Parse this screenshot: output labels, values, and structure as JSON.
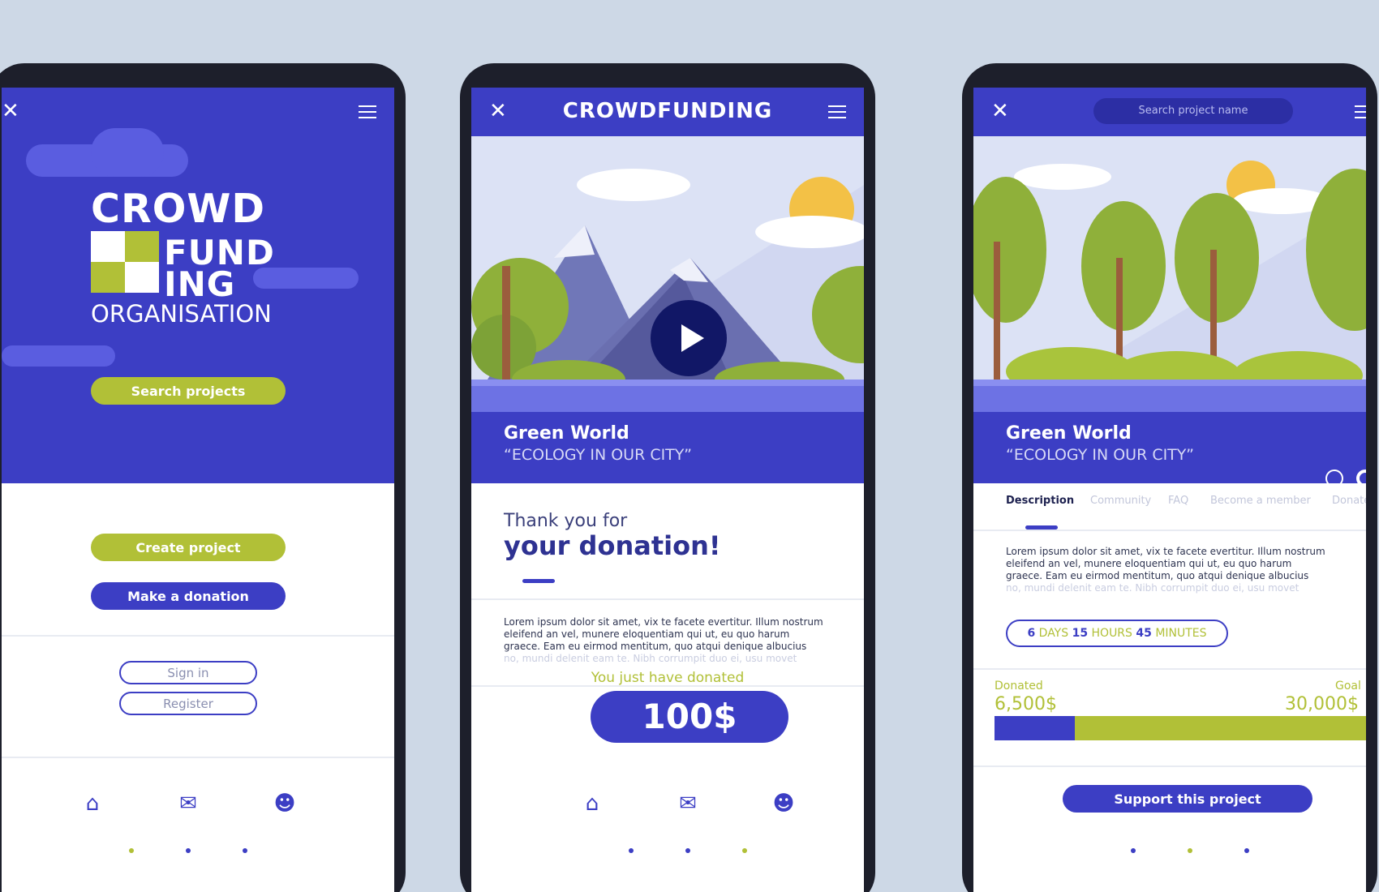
{
  "colors": {
    "background": "#cdd8e6",
    "primary": "#3c3ec4",
    "accent": "#b1c037",
    "device": "#1d1f2b"
  },
  "screen1": {
    "logo_line1": "CROWD",
    "logo_line2": "FUND",
    "logo_line3": "ING",
    "subtitle": "ORGANISATION",
    "search_button": "Search projects",
    "create_button": "Create project",
    "donate_button": "Make a donation",
    "signin_button": "Sign in",
    "register_button": "Register",
    "icons": [
      "close-icon",
      "menu-icon",
      "home-icon",
      "chat-icon",
      "users-icon"
    ]
  },
  "screen2": {
    "header_title": "CROWDFUNDING",
    "project_name": "Green World",
    "project_subtitle": "“ECOLOGY IN OUR CITY”",
    "thanks_line1": "Thank you for",
    "thanks_line2": "your donation!",
    "lorem": [
      "Lorem ipsum dolor sit amet, vix te facete evertitur. Illum nostrum",
      "eleifend an vel, munere eloquentiam qui ut, eu quo harum",
      "graece. Eam eu eirmod mentitum, quo atqui denique albucius",
      "no, mundi delenit eam te. Nibh corrumpit duo ei, usu movet"
    ],
    "donated_label": "You just have donated",
    "donated_amount": "100$"
  },
  "screen3": {
    "search_placeholder": "Search project name",
    "project_name": "Green World",
    "project_subtitle": "“ECOLOGY IN OUR CITY”",
    "tabs": [
      "Description",
      "Community",
      "FAQ",
      "Become a member",
      "Donate"
    ],
    "lorem": [
      "Lorem ipsum dolor sit amet, vix te facete evertitur. Illum nostrum",
      "eleifend an vel, munere eloquentiam qui ut, eu quo harum",
      "graece. Eam eu eirmod mentitum, quo atqui denique albucius",
      "no, mundi delenit eam te. Nibh corrumpit duo ei, usu movet"
    ],
    "timer": {
      "days": "6",
      "days_label": "DAYS",
      "hours": "15",
      "hours_label": "HOURS",
      "minutes": "45",
      "minutes_label": "MINUTES"
    },
    "donated_label": "Donated",
    "donated_value": "6,500$",
    "goal_label": "Goal",
    "goal_value": "30,000$",
    "progress_fraction": 0.217,
    "support_button": "Support this project"
  }
}
